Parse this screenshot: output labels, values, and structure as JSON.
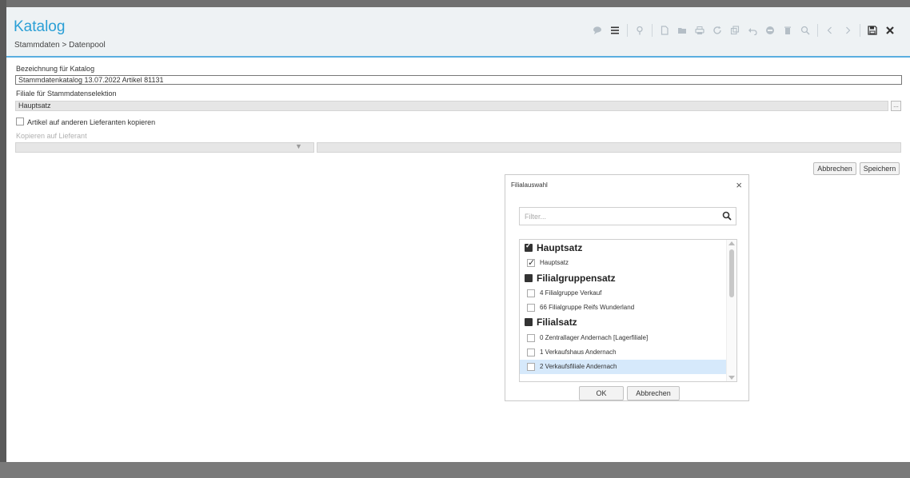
{
  "header": {
    "title": "Katalog",
    "breadcrumb": "Stammdaten  >  Datenpool"
  },
  "toolbar": {
    "icons": [
      "comment-icon",
      "list-icon",
      "pin-icon",
      "new-document-icon",
      "folder-icon",
      "print-icon",
      "refresh-icon",
      "copy-icon",
      "undo-icon",
      "cancel-icon",
      "delete-icon",
      "search-icon",
      "prev-icon",
      "next-icon",
      "save-icon",
      "close-icon"
    ]
  },
  "form": {
    "catalog_label": "Bezeichnung für Katalog",
    "catalog_value": "Stammdatenkatalog 13.07.2022 Artikel 81131",
    "branch_label": "Filiale für Stammdatenselektion",
    "branch_value": "Hauptsatz",
    "ellipsis": "...",
    "copy_checkbox_label": "Artikel auf anderen Lieferanten kopieren",
    "copy_to_supplier_label": "Kopieren auf Lieferant",
    "copy_checkbox_checked": false
  },
  "actions": {
    "cancel": "Abbrechen",
    "save": "Speichern"
  },
  "dialog": {
    "title": "Filialauswahl",
    "close": "×",
    "filter_placeholder": "Filter...",
    "items": [
      {
        "label": "Hauptsatz",
        "type": "group",
        "checked": true
      },
      {
        "label": "Hauptsatz",
        "type": "item",
        "checked": true
      },
      {
        "label": "Filialgruppensatz",
        "type": "group",
        "checked": false
      },
      {
        "label": "4 Filialgruppe Verkauf",
        "type": "item",
        "checked": false
      },
      {
        "label": "66 Filialgruppe Reifs Wunderland",
        "type": "item",
        "checked": false
      },
      {
        "label": "Filialsatz",
        "type": "group",
        "checked": false
      },
      {
        "label": "0 Zentrallager Andernach [Lagerfiliale]",
        "type": "item",
        "checked": false
      },
      {
        "label": "1 Verkaufshaus Andernach",
        "type": "item",
        "checked": false
      },
      {
        "label": "2 Verkaufsfiliale Andernach",
        "type": "item",
        "checked": false,
        "selected": true
      }
    ],
    "ok": "OK",
    "cancel": "Abbrechen"
  },
  "colors": {
    "accent": "#2a9fd6",
    "header_bg": "#eef2f4",
    "selection": "#d6e9fb"
  }
}
